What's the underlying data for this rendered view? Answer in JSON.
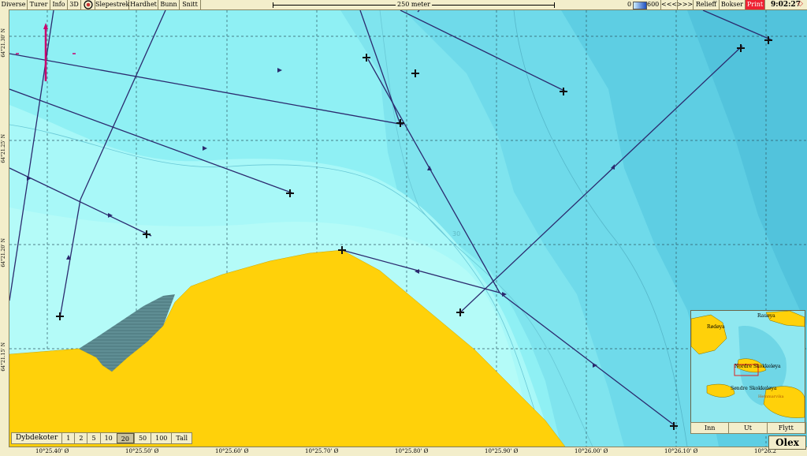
{
  "menu": [
    "Diverse",
    "Turer",
    "Info",
    "3D",
    "Slepestrek",
    "Hardhet",
    "Bunn",
    "Snitt"
  ],
  "scale_label": "250 meter",
  "depth_range": {
    "min": "0",
    "max": "600"
  },
  "right_buttons": [
    "<<<",
    ">>>",
    "Relieff",
    "Bokser",
    "Print"
  ],
  "clock": "9:02:27",
  "latitudes": [
    "64°21.30' N",
    "64°21.25' N",
    "64°21.20' N",
    "64°21.15' N"
  ],
  "longitudes": [
    "10°25.40' Ø",
    "10°25.50' Ø",
    "10°25.60' Ø",
    "10°25.70' Ø",
    "10°25.80' Ø",
    "10°25.90' Ø",
    "10°26.00' Ø",
    "10°26.10' Ø",
    "10°26.2"
  ],
  "depth_label": "30",
  "dybdekoter": {
    "label": "Dybdekoter",
    "options": [
      "1",
      "2",
      "5",
      "10",
      "20",
      "50",
      "100",
      "Tall"
    ],
    "selected": "20"
  },
  "minimap": {
    "places": [
      "Rødøya",
      "Rauøya",
      "Nordre Skokkeløya",
      "Søndre Skokkeløya",
      "Hemmarvika"
    ],
    "buttons": [
      "Inn",
      "Ut",
      "Flytt"
    ]
  },
  "brand": "Olex",
  "colors": {
    "land": "#ffd10a",
    "shallow": "#a8f8f8",
    "mid": "#8ff0f4",
    "deep": "#6fdaea",
    "deeper": "#58c9df",
    "track": "#2b2a6e",
    "mark": "#c8006e"
  }
}
